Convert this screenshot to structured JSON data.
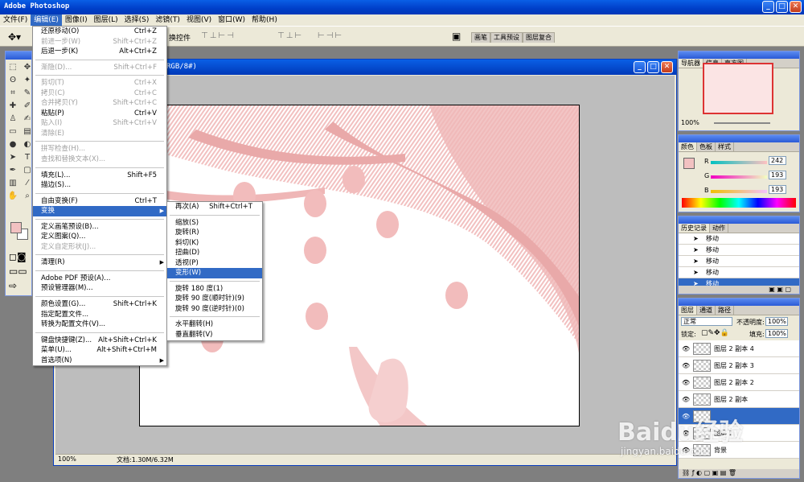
{
  "app": {
    "title": "Adobe Photoshop",
    "min": "_",
    "max": "□",
    "close": "✕"
  },
  "menubar": [
    "文件(F)",
    "编辑(E)",
    "图像(I)",
    "图层(L)",
    "选择(S)",
    "滤镜(T)",
    "视图(V)",
    "窗口(W)",
    "帮助(H)"
  ],
  "options_bar": {
    "tool_icon": "move-tool-icon",
    "label": "换控件",
    "tabs": [
      "画笔",
      "工具预设",
      "图层复合"
    ]
  },
  "document": {
    "title": "RGB/8#)",
    "zoom": "100%",
    "doc_size": "文档:1.30M/6.32M"
  },
  "edit_menu": [
    {
      "label": "还原移动(O)",
      "shortcut": "Ctrl+Z",
      "disabled": false
    },
    {
      "label": "前进一步(W)",
      "shortcut": "Shift+Ctrl+Z",
      "disabled": true
    },
    {
      "label": "后退一步(K)",
      "shortcut": "Alt+Ctrl+Z",
      "disabled": false
    },
    {
      "sep": true
    },
    {
      "label": "渐隐(D)...",
      "shortcut": "Shift+Ctrl+F",
      "disabled": true
    },
    {
      "sep": true
    },
    {
      "label": "剪切(T)",
      "shortcut": "Ctrl+X",
      "disabled": true
    },
    {
      "label": "拷贝(C)",
      "shortcut": "Ctrl+C",
      "disabled": true
    },
    {
      "label": "合并拷贝(Y)",
      "shortcut": "Shift+Ctrl+C",
      "disabled": true
    },
    {
      "label": "粘贴(P)",
      "shortcut": "Ctrl+V",
      "disabled": false
    },
    {
      "label": "贴入(I)",
      "shortcut": "Shift+Ctrl+V",
      "disabled": true
    },
    {
      "label": "清除(E)",
      "shortcut": "",
      "disabled": true
    },
    {
      "sep": true
    },
    {
      "label": "拼写检查(H)...",
      "shortcut": "",
      "disabled": true
    },
    {
      "label": "查找和替换文本(X)...",
      "shortcut": "",
      "disabled": true
    },
    {
      "sep": true
    },
    {
      "label": "填充(L)...",
      "shortcut": "Shift+F5",
      "disabled": false
    },
    {
      "label": "描边(S)...",
      "shortcut": "",
      "disabled": false
    },
    {
      "sep": true
    },
    {
      "label": "自由变换(F)",
      "shortcut": "Ctrl+T",
      "disabled": false
    },
    {
      "label": "变换",
      "shortcut": "",
      "disabled": false,
      "submenu": true,
      "highlight": true
    },
    {
      "sep": true
    },
    {
      "label": "定义画笔预设(B)...",
      "shortcut": "",
      "disabled": false
    },
    {
      "label": "定义图案(Q)...",
      "shortcut": "",
      "disabled": false
    },
    {
      "label": "定义自定形状(J)...",
      "shortcut": "",
      "disabled": true
    },
    {
      "sep": true
    },
    {
      "label": "清理(R)",
      "shortcut": "",
      "disabled": false,
      "submenu": true
    },
    {
      "sep": true
    },
    {
      "label": "Adobe PDF 预设(A)...",
      "shortcut": "",
      "disabled": false
    },
    {
      "label": "预设管理器(M)...",
      "shortcut": "",
      "disabled": false
    },
    {
      "sep": true
    },
    {
      "label": "颜色设置(G)...",
      "shortcut": "Shift+Ctrl+K",
      "disabled": false
    },
    {
      "label": "指定配置文件...",
      "shortcut": "",
      "disabled": false
    },
    {
      "label": "转换为配置文件(V)...",
      "shortcut": "",
      "disabled": false
    },
    {
      "sep": true
    },
    {
      "label": "键盘快捷键(Z)...",
      "shortcut": "Alt+Shift+Ctrl+K",
      "disabled": false
    },
    {
      "label": "菜单(U)...",
      "shortcut": "Alt+Shift+Ctrl+M",
      "disabled": false
    },
    {
      "label": "首选项(N)",
      "shortcut": "",
      "disabled": false,
      "submenu": true
    }
  ],
  "transform_submenu": [
    {
      "label": "再次(A)",
      "shortcut": "Shift+Ctrl+T"
    },
    {
      "sep": true
    },
    {
      "label": "缩放(S)",
      "shortcut": ""
    },
    {
      "label": "旋转(R)",
      "shortcut": ""
    },
    {
      "label": "斜切(K)",
      "shortcut": ""
    },
    {
      "label": "扭曲(D)",
      "shortcut": ""
    },
    {
      "label": "透视(P)",
      "shortcut": ""
    },
    {
      "label": "变形(W)",
      "shortcut": "",
      "highlight": true
    },
    {
      "sep": true
    },
    {
      "label": "旋转 180 度(1)",
      "shortcut": ""
    },
    {
      "label": "旋转 90 度(顺时针)(9)",
      "shortcut": ""
    },
    {
      "label": "旋转 90 度(逆时针)(0)",
      "shortcut": ""
    },
    {
      "sep": true
    },
    {
      "label": "水平翻转(H)",
      "shortcut": ""
    },
    {
      "label": "垂直翻转(V)",
      "shortcut": ""
    }
  ],
  "navigator": {
    "tabs": [
      "导航器",
      "信息",
      "直方图"
    ],
    "zoom": "100%"
  },
  "color_panel": {
    "tabs": [
      "颜色",
      "色板",
      "样式"
    ],
    "r_label": "R",
    "g_label": "G",
    "b_label": "B",
    "r": "242",
    "g": "193",
    "b": "193",
    "fg_color": "#f2c1c1"
  },
  "history_panel": {
    "tabs": [
      "历史记录",
      "动作"
    ],
    "items": [
      "移动",
      "移动",
      "移动",
      "移动",
      "移动"
    ]
  },
  "layers_panel": {
    "tabs": [
      "图层",
      "通道",
      "路径"
    ],
    "blend_mode": "正常",
    "opacity_label": "不透明度:",
    "opacity": "100%",
    "lock_label": "锁定:",
    "fill_label": "填充:",
    "fill": "100%",
    "layers": [
      {
        "name": "图层 2 副本 4",
        "selected": false
      },
      {
        "name": "图层 2 副本 3",
        "selected": false
      },
      {
        "name": "图层 2 副本 2",
        "selected": false
      },
      {
        "name": "图层 2 副本",
        "selected": false
      },
      {
        "name": "",
        "selected": true
      },
      {
        "name": "图层 1",
        "selected": false
      },
      {
        "name": "背景",
        "selected": false
      }
    ]
  },
  "watermark": {
    "brand": "Baidu经验",
    "url": "jingyan.baidu.com"
  },
  "colors": {
    "accent": "#316ac5",
    "titlebar": "#0a5fe6",
    "artwork_pink": "#f2c1c1"
  }
}
